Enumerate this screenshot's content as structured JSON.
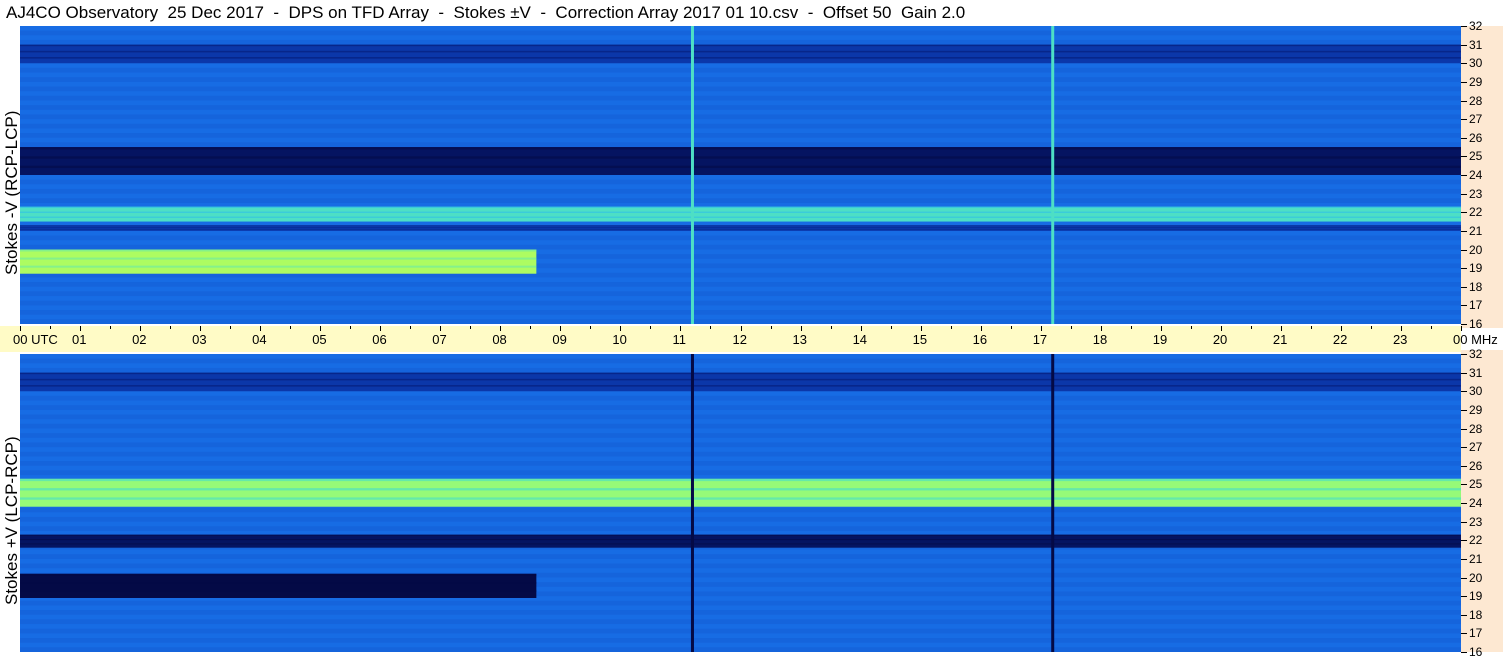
{
  "title": "AJ4CO Observatory  25 Dec 2017  -  DPS on TFD Array  -  Stokes ±V  -  Correction Array 2017 01 10.csv  -  Offset 50  Gain 2.0",
  "panels": [
    {
      "ylabel": "Stokes -V (RCP-LCP)"
    },
    {
      "ylabel": "Stokes +V (LCP-RCP)"
    }
  ],
  "time_axis": {
    "labels": [
      "00 UTC",
      "01",
      "02",
      "03",
      "04",
      "05",
      "06",
      "07",
      "08",
      "09",
      "10",
      "11",
      "12",
      "13",
      "14",
      "15",
      "16",
      "17",
      "18",
      "19",
      "20",
      "21",
      "22",
      "23",
      "00 MHz"
    ]
  },
  "freq_axis": {
    "labels": [
      "32",
      "31",
      "30",
      "29",
      "28",
      "27",
      "26",
      "25",
      "24",
      "23",
      "22",
      "21",
      "20",
      "19",
      "18",
      "17",
      "16"
    ]
  },
  "colors": {
    "background_blue": "#1a6fe0",
    "dark": "#061a6a",
    "bright": "#ccff3a",
    "time_axis_bg": "#fffbc6",
    "freq_axis_bg": "#fde8d2"
  },
  "chart_data": {
    "type": "heatmap",
    "x_range_utc_hours": [
      0,
      24
    ],
    "y_range_mhz": [
      16,
      32
    ],
    "xlabel": "UTC",
    "ylabel_units": "MHz",
    "panels": [
      {
        "name": "Stokes -V (RCP-LCP)",
        "bands": [
          {
            "f_low": 24.0,
            "f_high": 25.5,
            "t_start": 0,
            "t_end": 24,
            "level": 0.05
          },
          {
            "f_low": 21.5,
            "f_high": 22.3,
            "t_start": 0,
            "t_end": 24,
            "level": 0.75
          },
          {
            "f_low": 21.0,
            "f_high": 21.3,
            "t_start": 0,
            "t_end": 24,
            "level": 0.2
          },
          {
            "f_low": 18.7,
            "f_high": 20.0,
            "t_start": 0,
            "t_end": 8.6,
            "level": 0.9
          },
          {
            "f_low": 30.0,
            "f_high": 31.0,
            "t_start": 0,
            "t_end": 24,
            "level": 0.2
          }
        ],
        "vertical_lines_utc": [
          11.2,
          17.2
        ],
        "vertical_line_level": 0.75
      },
      {
        "name": "Stokes +V (LCP-RCP)",
        "bands": [
          {
            "f_low": 23.8,
            "f_high": 25.3,
            "t_start": 0,
            "t_end": 24,
            "level": 0.85
          },
          {
            "f_low": 21.6,
            "f_high": 22.3,
            "t_start": 0,
            "t_end": 24,
            "level": 0.05
          },
          {
            "f_low": 18.9,
            "f_high": 20.2,
            "t_start": 0,
            "t_end": 8.6,
            "level": 0.0
          },
          {
            "f_low": 30.0,
            "f_high": 31.0,
            "t_start": 0,
            "t_end": 24,
            "level": 0.2
          }
        ],
        "vertical_lines_utc": [
          11.2,
          17.2
        ],
        "vertical_line_level": 0.0
      }
    ]
  }
}
